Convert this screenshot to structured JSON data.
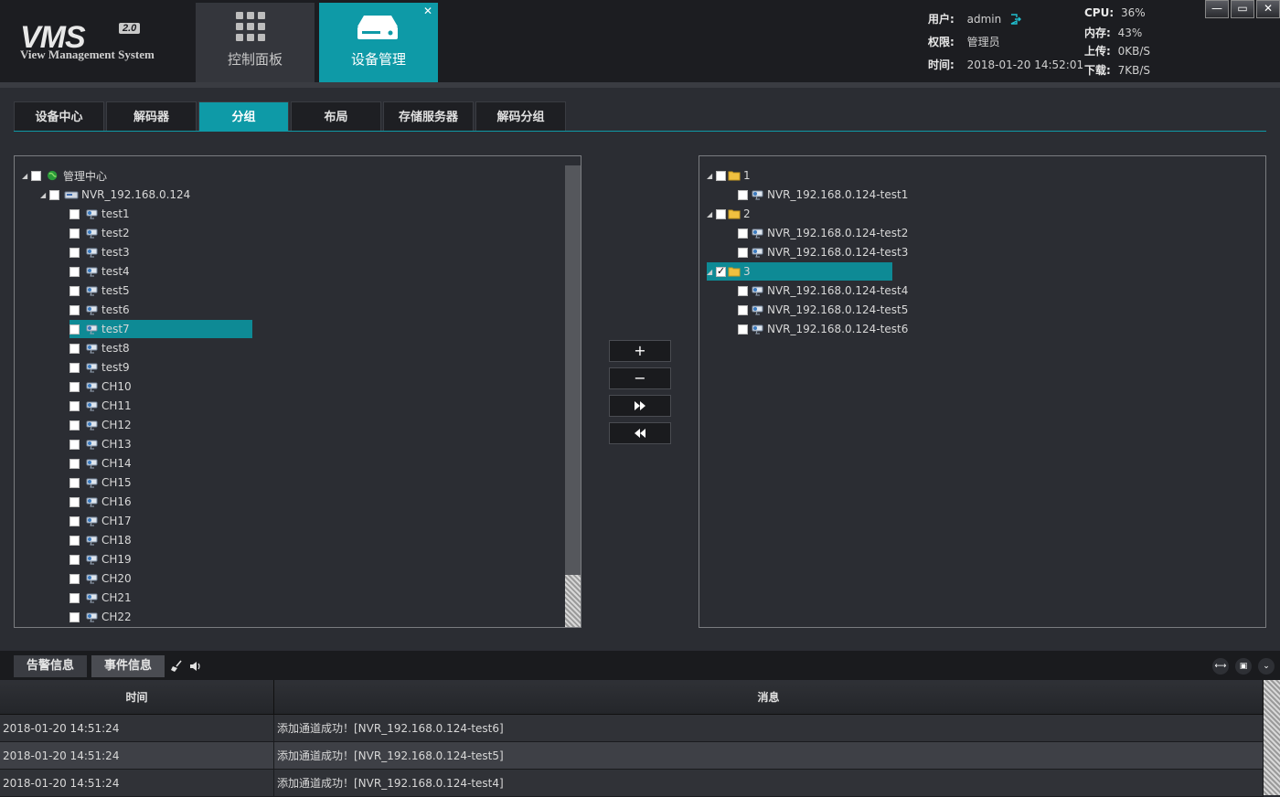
{
  "app": {
    "logo": "VMS",
    "version": "2.0",
    "subtitle": "View Management System"
  },
  "main_tabs": [
    {
      "label": "控制面板"
    },
    {
      "label": "设备管理"
    }
  ],
  "user_info": {
    "user_label": "用户:",
    "user_value": "admin",
    "perm_label": "权限:",
    "perm_value": "管理员",
    "time_label": "时间:",
    "time_value": "2018-01-20 14:52:01"
  },
  "stats": {
    "cpu_label": "CPU:",
    "cpu_value": "36%",
    "mem_label": "内存:",
    "mem_value": "43%",
    "up_label": "上传:",
    "up_value": "0KB/S",
    "down_label": "下载:",
    "down_value": "7KB/S"
  },
  "window_buttons": {
    "minimize": "—",
    "maximize": "▭",
    "close": "✕"
  },
  "sub_tabs": [
    "设备中心",
    "解码器",
    "分组",
    "布局",
    "存储服务器",
    "解码分组"
  ],
  "left_tree": {
    "root": "管理中心",
    "nvr": "NVR_192.168.0.124",
    "channels": [
      "test1",
      "test2",
      "test3",
      "test4",
      "test5",
      "test6",
      "test7",
      "test8",
      "test9",
      "CH10",
      "CH11",
      "CH12",
      "CH13",
      "CH14",
      "CH15",
      "CH16",
      "CH17",
      "CH18",
      "CH19",
      "CH20",
      "CH21",
      "CH22"
    ]
  },
  "mid_buttons": {
    "add": "+",
    "remove": "−",
    "add_all": "⏩",
    "remove_all": "⏪"
  },
  "right_tree": {
    "groups": [
      {
        "name": "1",
        "items": [
          "NVR_192.168.0.124-test1"
        ]
      },
      {
        "name": "2",
        "items": [
          "NVR_192.168.0.124-test2",
          "NVR_192.168.0.124-test3"
        ]
      },
      {
        "name": "3",
        "items": [
          "NVR_192.168.0.124-test4",
          "NVR_192.168.0.124-test5",
          "NVR_192.168.0.124-test6"
        ]
      }
    ]
  },
  "bottom": {
    "tab_alarm": "告警信息",
    "tab_event": "事件信息",
    "col_time": "时间",
    "col_msg": "消息",
    "rows": [
      {
        "time": "2018-01-20 14:51:24",
        "msg": "添加通道成功！[NVR_192.168.0.124-test6]"
      },
      {
        "time": "2018-01-20 14:51:24",
        "msg": "添加通道成功！[NVR_192.168.0.124-test5]"
      },
      {
        "time": "2018-01-20 14:51:24",
        "msg": "添加通道成功！[NVR_192.168.0.124-test4]"
      }
    ]
  }
}
